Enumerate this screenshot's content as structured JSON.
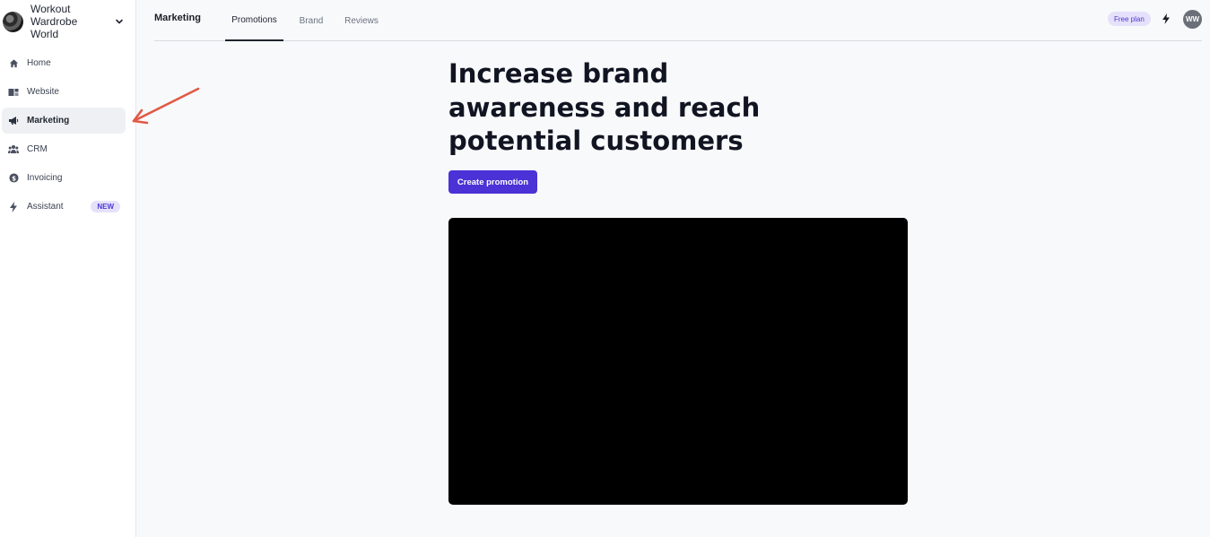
{
  "sidebar": {
    "brand": {
      "name": "Workout Wardrobe World"
    },
    "items": [
      {
        "label": "Home",
        "icon": "home-icon"
      },
      {
        "label": "Website",
        "icon": "website-icon"
      },
      {
        "label": "Marketing",
        "icon": "megaphone-icon"
      },
      {
        "label": "CRM",
        "icon": "people-icon"
      },
      {
        "label": "Invoicing",
        "icon": "dollar-icon"
      },
      {
        "label": "Assistant",
        "icon": "bolt-icon",
        "badge": "NEW"
      }
    ],
    "active_item": "Marketing"
  },
  "topbar": {
    "section_title": "Marketing",
    "tabs": [
      {
        "label": "Promotions",
        "active": true
      },
      {
        "label": "Brand",
        "active": false
      },
      {
        "label": "Reviews",
        "active": false
      }
    ],
    "plan_badge": "Free plan",
    "avatar_initials": "WW"
  },
  "main": {
    "headline": "Increase brand awareness and reach potential customers",
    "cta_label": "Create promotion"
  },
  "colors": {
    "accent": "#4a32d6",
    "badge_bg": "#e6e1fb",
    "annotation_arrow": "#e05a47"
  }
}
